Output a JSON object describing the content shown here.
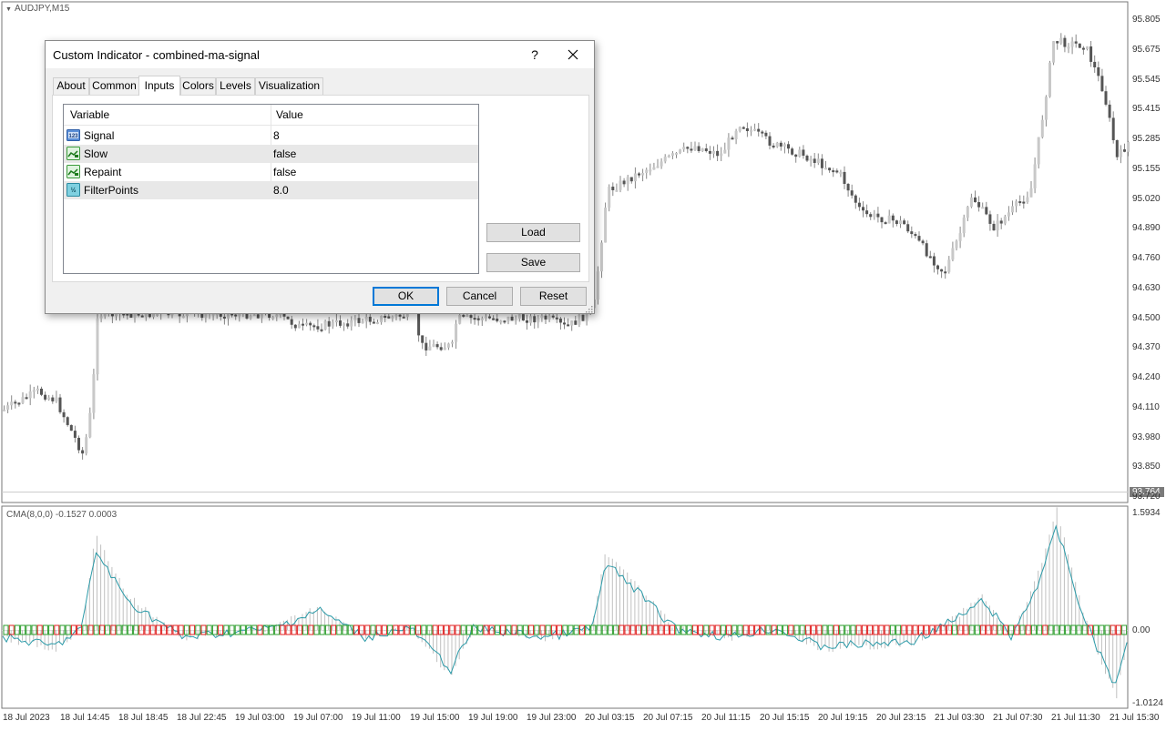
{
  "chart": {
    "symbol": "AUDJPY,M15",
    "price_axis": [
      "95.805",
      "95.675",
      "95.545",
      "95.415",
      "95.285",
      "95.155",
      "95.020",
      "94.890",
      "94.760",
      "94.630",
      "94.500",
      "94.370",
      "94.240",
      "94.110",
      "93.980",
      "93.850",
      "93.720"
    ],
    "current_price": "93.764",
    "indicator_label": "CMA(8,0,0) -0.1527 0.0003",
    "indicator_axis": [
      "1.5934",
      "0.00",
      "-1.0124"
    ],
    "time_axis": [
      "18 Jul 2023",
      "18 Jul 14:45",
      "18 Jul 18:45",
      "18 Jul 22:45",
      "19 Jul 03:00",
      "19 Jul 07:00",
      "19 Jul 11:00",
      "19 Jul 15:00",
      "19 Jul 19:00",
      "19 Jul 23:00",
      "20 Jul 03:15",
      "20 Jul 07:15",
      "20 Jul 11:15",
      "20 Jul 15:15",
      "20 Jul 19:15",
      "20 Jul 23:15",
      "21 Jul 03:30",
      "21 Jul 07:30",
      "21 Jul 11:30",
      "21 Jul 15:30"
    ],
    "colors": {
      "candle_up": "#c8c8c8",
      "candle_down": "#555555",
      "indicator_line": "#2a9aa8",
      "signal_up": "#2e9e2e",
      "signal_down": "#e02020",
      "histogram": "#c0c0c0"
    }
  },
  "dialog": {
    "title": "Custom Indicator - combined-ma-signal",
    "help_label": "?",
    "tabs": [
      {
        "label": "About",
        "active": false
      },
      {
        "label": "Common",
        "active": false
      },
      {
        "label": "Inputs",
        "active": true
      },
      {
        "label": "Colors",
        "active": false
      },
      {
        "label": "Levels",
        "active": false
      },
      {
        "label": "Visualization",
        "active": false
      }
    ],
    "grid": {
      "col_variable": "Variable",
      "col_value": "Value",
      "rows": [
        {
          "name": "Signal",
          "value": "8",
          "icon": "integer-icon"
        },
        {
          "name": "Slow",
          "value": "false",
          "icon": "boolean-icon"
        },
        {
          "name": "Repaint",
          "value": "false",
          "icon": "boolean-icon"
        },
        {
          "name": "FilterPoints",
          "value": "8.0",
          "icon": "double-icon"
        }
      ]
    },
    "buttons": {
      "load": "Load",
      "save": "Save",
      "ok": "OK",
      "cancel": "Cancel",
      "reset": "Reset"
    }
  }
}
